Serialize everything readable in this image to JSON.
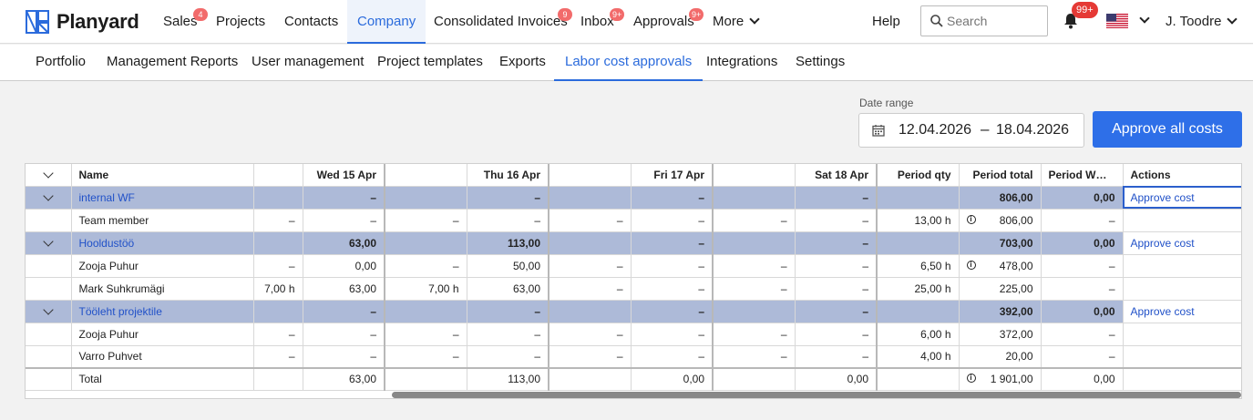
{
  "app": {
    "brand": "Planyard"
  },
  "nav": [
    {
      "label": "Sales",
      "badge": "4"
    },
    {
      "label": "Projects",
      "badge": ""
    },
    {
      "label": "Contacts",
      "badge": ""
    },
    {
      "label": "Company",
      "badge": ""
    },
    {
      "label": "Consolidated Invoices",
      "badge": "9"
    },
    {
      "label": "Inbox",
      "badge": "9+"
    },
    {
      "label": "Approvals",
      "badge": "9+"
    },
    {
      "label": "More",
      "badge": ""
    }
  ],
  "header": {
    "help": "Help",
    "search_placeholder": "Search",
    "notifications": "99+",
    "user": "J. Toodre"
  },
  "subnav": [
    "Portfolio",
    "Management Reports",
    "User management",
    "Project templates",
    "Exports",
    "Labor cost approvals",
    "Integrations",
    "Settings"
  ],
  "date_range": {
    "label": "Date range",
    "from": "12.04.2026",
    "separator": "–",
    "to": "18.04.2026"
  },
  "approve_all": "Approve all costs",
  "table": {
    "columns": [
      "",
      "Name",
      "",
      "Wed 15 Apr",
      "",
      "Thu 16 Apr",
      "",
      "Fri 17 Apr",
      "",
      "Sat 18 Apr",
      "Period qty",
      "Period total",
      "Period WO ...",
      "Actions"
    ],
    "rows": [
      {
        "type": "group",
        "cells": [
          "internal WF",
          "",
          "–",
          "",
          "–",
          "",
          "–",
          "",
          "–",
          "",
          "806,00",
          "0,00",
          "Approve cost"
        ]
      },
      {
        "type": "item",
        "cells": [
          "Team member",
          "–",
          "–",
          "–",
          "–",
          "–",
          "–",
          "–",
          "–",
          "13,00 h",
          "806,00",
          "–",
          ""
        ],
        "info": true
      },
      {
        "type": "group",
        "cells": [
          "Hooldustöö",
          "",
          "63,00",
          "",
          "113,00",
          "",
          "–",
          "",
          "–",
          "",
          "703,00",
          "0,00",
          "Approve cost"
        ]
      },
      {
        "type": "item",
        "cells": [
          "Zooja Puhur",
          "–",
          "0,00",
          "–",
          "50,00",
          "–",
          "–",
          "–",
          "–",
          "6,50 h",
          "478,00",
          "–",
          ""
        ],
        "info": true
      },
      {
        "type": "item",
        "cells": [
          "Mark Suhkrumägi",
          "7,00 h",
          "63,00",
          "7,00 h",
          "63,00",
          "–",
          "–",
          "–",
          "–",
          "25,00 h",
          "225,00",
          "–",
          ""
        ],
        "info": false
      },
      {
        "type": "group",
        "cells": [
          "Tööleht projektile",
          "",
          "–",
          "",
          "–",
          "",
          "–",
          "",
          "–",
          "",
          "392,00",
          "0,00",
          "Approve cost"
        ]
      },
      {
        "type": "item",
        "cells": [
          "Zooja Puhur",
          "–",
          "–",
          "–",
          "–",
          "–",
          "–",
          "–",
          "–",
          "6,00 h",
          "372,00",
          "–",
          ""
        ],
        "info": false
      },
      {
        "type": "item",
        "cells": [
          "Varro Puhvet",
          "–",
          "–",
          "–",
          "–",
          "–",
          "–",
          "–",
          "–",
          "4,00 h",
          "20,00",
          "–",
          ""
        ],
        "info": false
      }
    ],
    "total": [
      "Total",
      "",
      "63,00",
      "",
      "113,00",
      "",
      "0,00",
      "",
      "0,00",
      "",
      "1 901,00",
      "0,00",
      ""
    ]
  }
}
